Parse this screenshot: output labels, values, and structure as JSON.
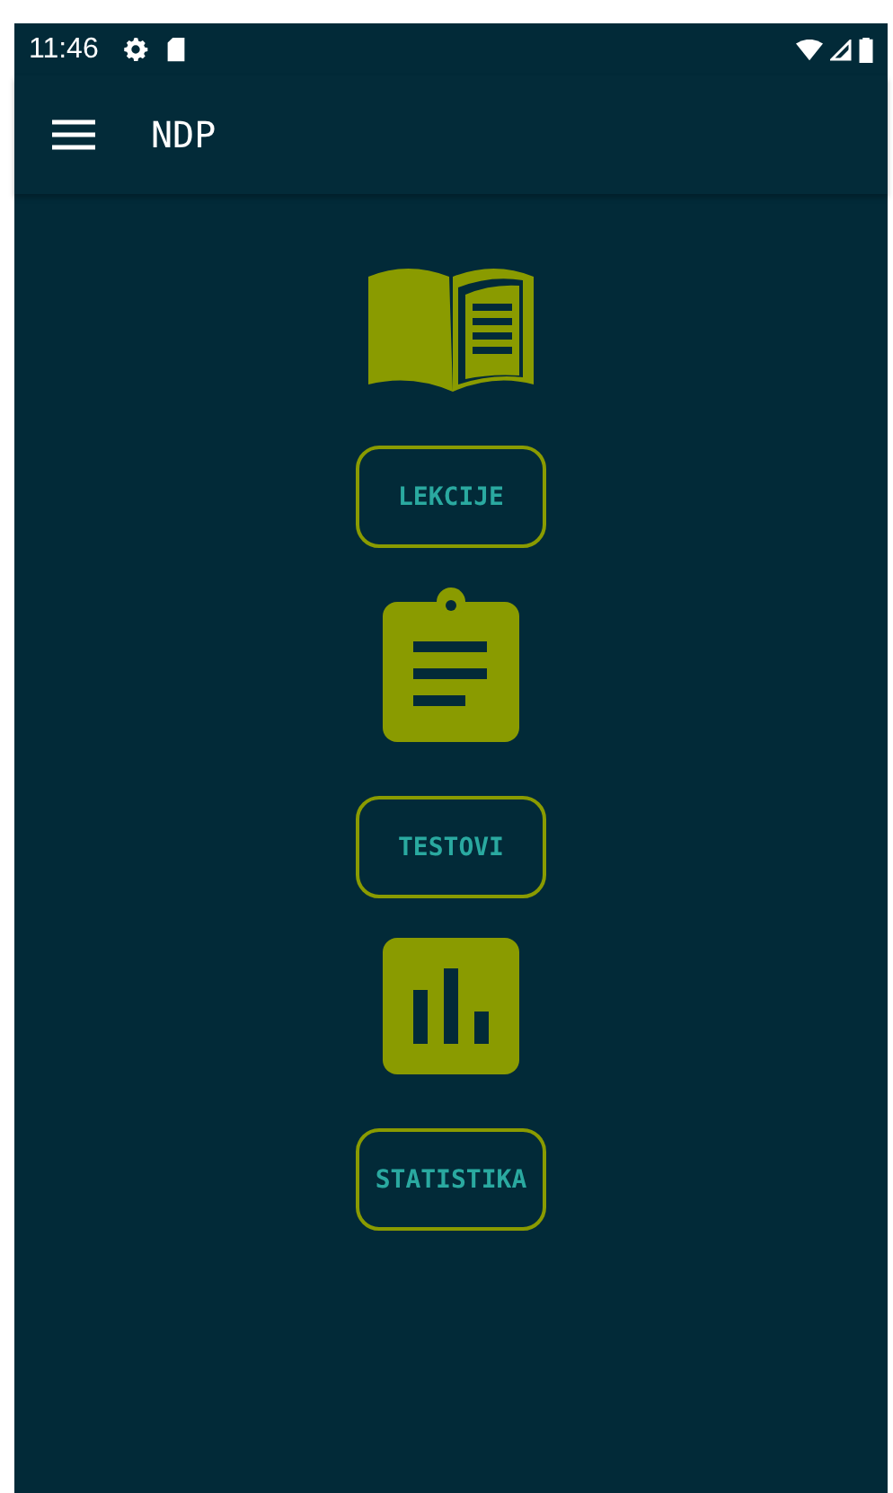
{
  "status_bar": {
    "time": "11:46"
  },
  "app_bar": {
    "title": "NDP"
  },
  "menu": [
    {
      "kind": "book",
      "label": "LEKCIJE"
    },
    {
      "kind": "clipboard",
      "label": "TESTOVI"
    },
    {
      "kind": "chart",
      "label": "STATISTIKA"
    }
  ]
}
